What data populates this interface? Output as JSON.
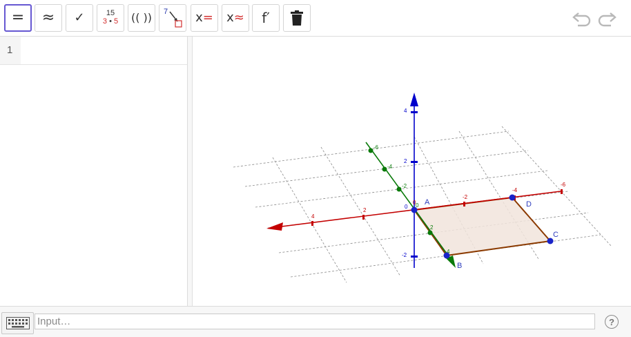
{
  "toolbar": {
    "buttons": [
      {
        "id": "symbolic",
        "label": "="
      },
      {
        "id": "numeric",
        "label": "≈"
      },
      {
        "id": "check",
        "label": "✓"
      },
      {
        "id": "factor",
        "top": "15",
        "bottom_a": "3",
        "bottom_dot": "•",
        "bottom_b": "5"
      },
      {
        "id": "expand",
        "label": "(( ))"
      },
      {
        "id": "substitute",
        "label": "7"
      },
      {
        "id": "solve",
        "var": "x",
        "op": "="
      },
      {
        "id": "solve-numeric",
        "var": "x",
        "op": "≈"
      },
      {
        "id": "derivative",
        "label": "f′"
      },
      {
        "id": "delete",
        "icon": "trash-icon"
      }
    ],
    "history": {
      "undo_icon": "undo-icon",
      "redo_icon": "redo-icon"
    }
  },
  "algebra": {
    "rows": [
      {
        "number": "1",
        "value": ""
      }
    ]
  },
  "graphics": {
    "axis_colors": {
      "x": "#cc0000",
      "y": "#007700",
      "z": "#0000cc"
    },
    "z_ticks": [
      "4",
      "2",
      "-2"
    ],
    "x_ticks": [
      "4",
      "2",
      "-2",
      "-4",
      "-6"
    ],
    "y_ticks": [
      "0",
      "-6",
      "-4",
      "-2",
      "2",
      "4"
    ],
    "origin_labels": [
      "0",
      "0",
      "0"
    ],
    "points": {
      "A": "A",
      "B": "B",
      "C": "C",
      "D": "D"
    },
    "quad_fill": "#f1e4dc",
    "quad_stroke": "#8b3a00",
    "point_color": "#1a24c8"
  },
  "input": {
    "placeholder": "Input…",
    "value": ""
  },
  "help_label": "?"
}
